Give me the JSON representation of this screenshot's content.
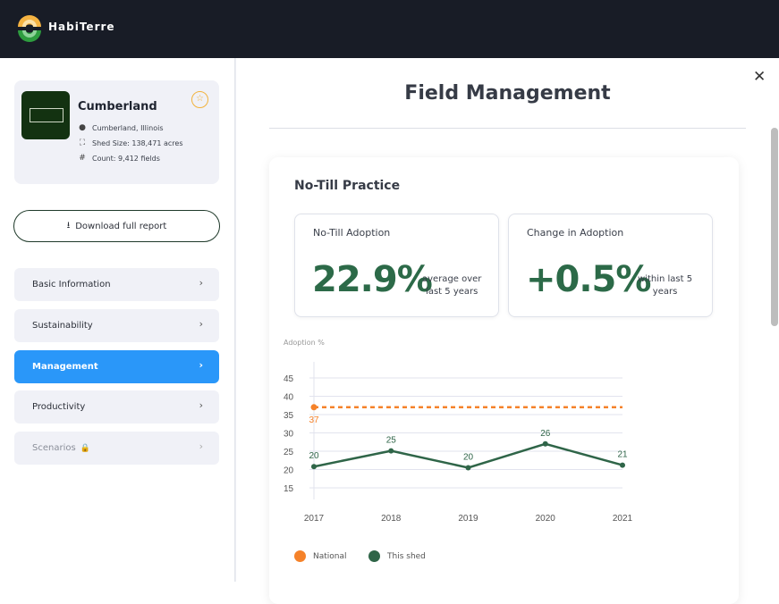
{
  "app": {
    "brand": "HabiTerre"
  },
  "location": {
    "name": "Cumberland",
    "place": "Cumberland, Illinois",
    "shed_size": "Shed Size: 138,471 acres",
    "count": "Count: 9,412 fields"
  },
  "download_label": "Download full report",
  "nav": [
    {
      "label": "Basic Information",
      "state": "normal"
    },
    {
      "label": "Sustainability",
      "state": "normal"
    },
    {
      "label": "Management",
      "state": "active"
    },
    {
      "label": "Productivity",
      "state": "normal"
    },
    {
      "label": "Scenarios",
      "state": "locked"
    }
  ],
  "page": {
    "title": "Field Management"
  },
  "section": {
    "title": "No-Till Practice",
    "kpis": [
      {
        "label": "No-Till Adoption",
        "value": "22.9%",
        "note_line1": "average over",
        "note_line2": "last 5 years"
      },
      {
        "label": "Change in Adoption",
        "value": "+0.5%",
        "note_line1": "within last 5",
        "note_line2": "years"
      }
    ]
  },
  "colors": {
    "national": "#f5822a",
    "shed": "#2f6548",
    "active_nav": "#2a97f9",
    "kpi_value": "#2c6a48"
  },
  "chart_data": {
    "type": "line",
    "ylabel": "Adoption %",
    "x": [
      "2017",
      "2018",
      "2019",
      "2020",
      "2021"
    ],
    "yticks": [
      15,
      20,
      25,
      30,
      35,
      40,
      45
    ],
    "ylim": [
      11,
      50
    ],
    "grid": true,
    "legend_position": "bottom-left",
    "series": [
      {
        "name": "National",
        "values": [
          37,
          37,
          37,
          37,
          37
        ],
        "labels": [
          "37",
          "",
          "",
          "",
          ""
        ],
        "style": "dashed",
        "color": "#f5822a"
      },
      {
        "name": "This shed",
        "values": [
          20.8,
          25.1,
          20.5,
          27.0,
          21.2
        ],
        "labels": [
          "20",
          "25",
          "20",
          "26",
          "21"
        ],
        "style": "solid",
        "color": "#2f6548"
      }
    ]
  }
}
